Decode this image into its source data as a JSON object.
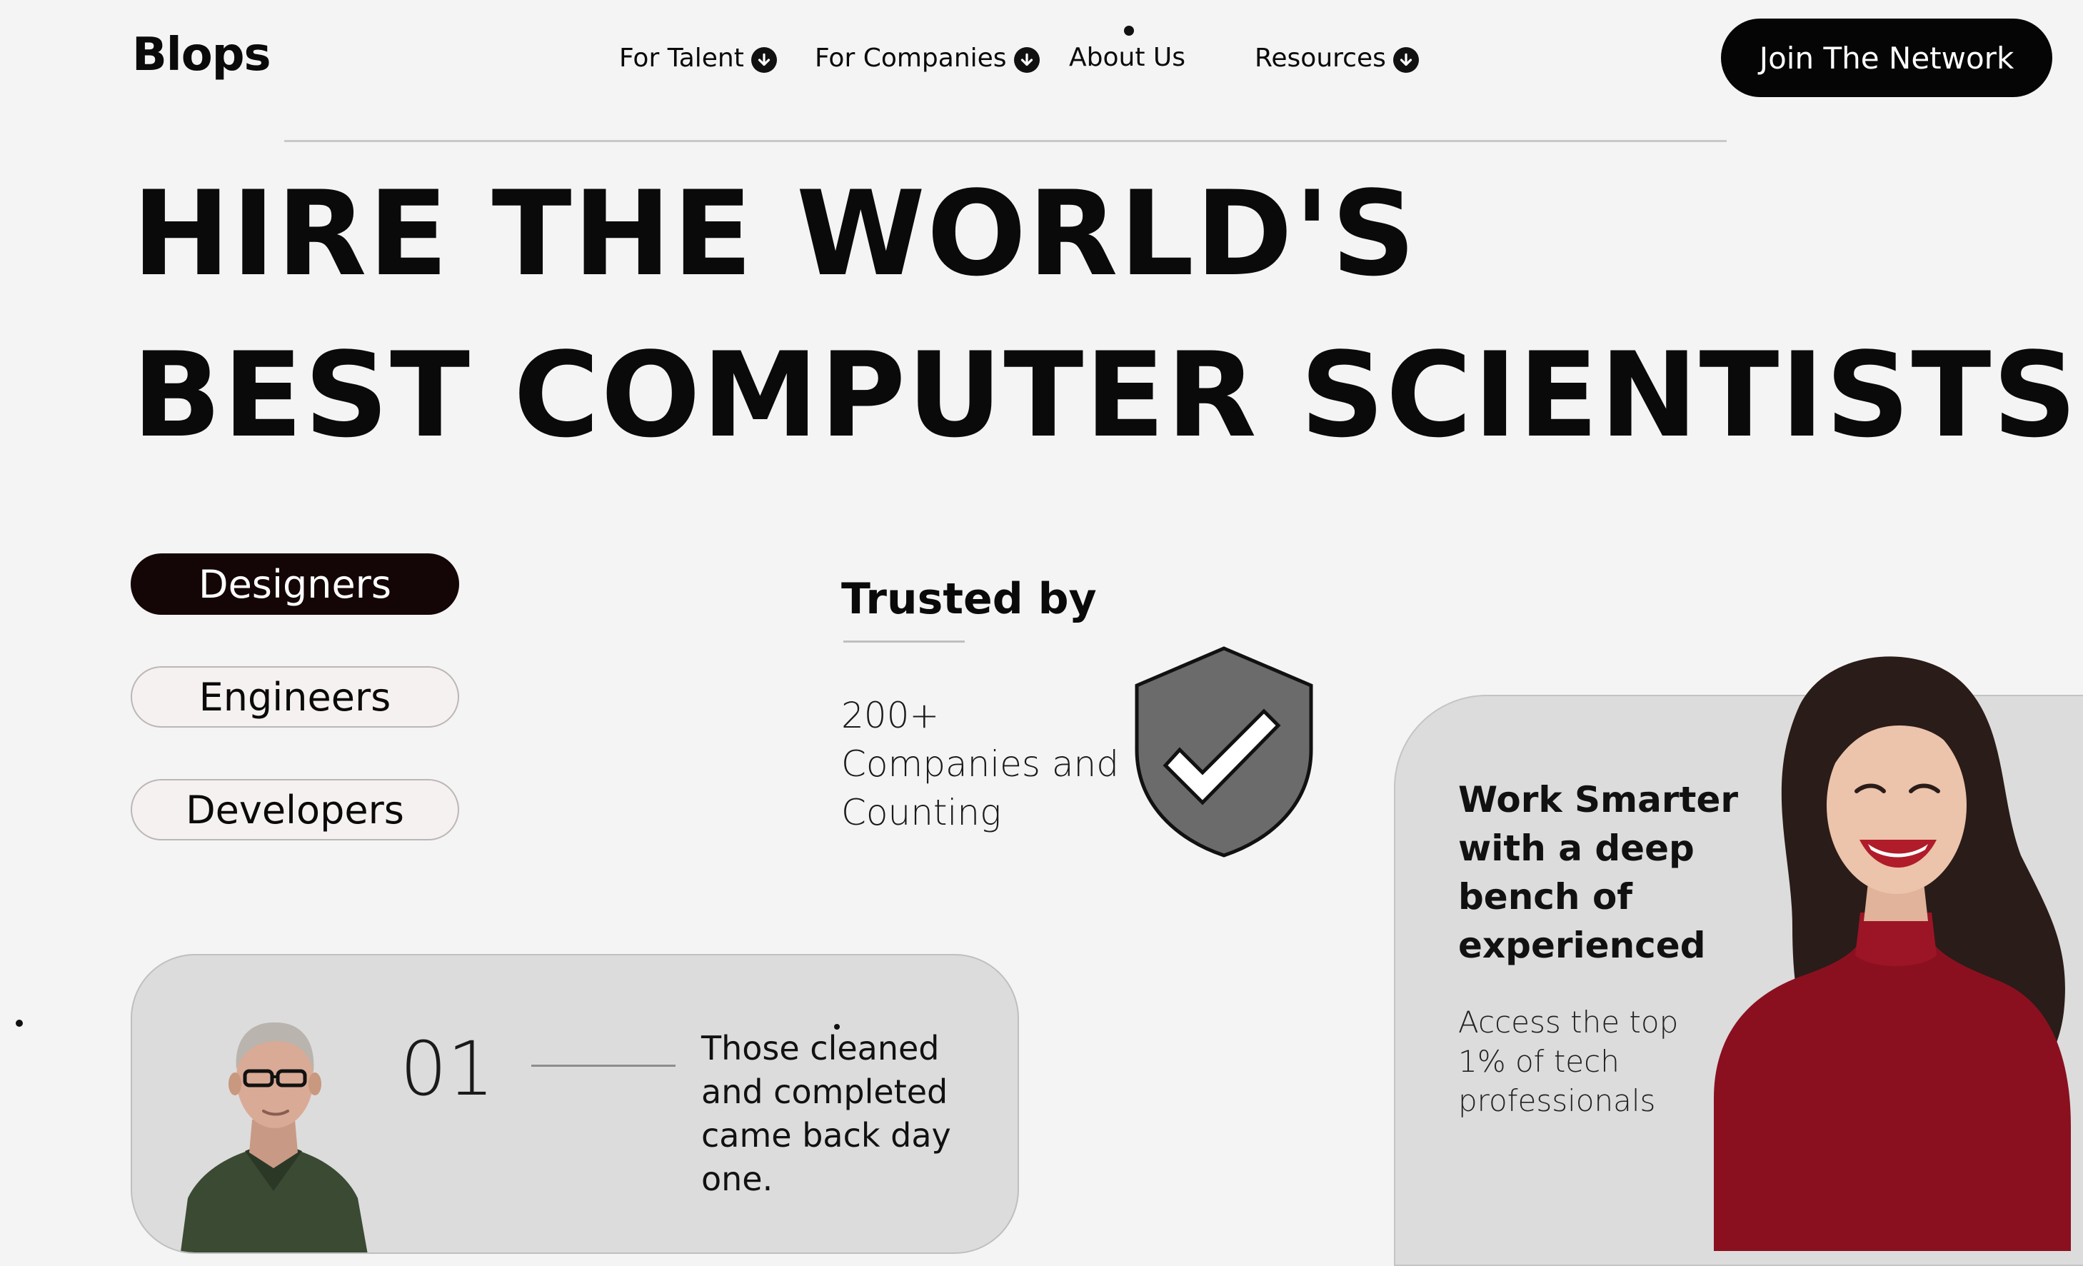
{
  "header": {
    "logo": "Blops",
    "nav": [
      {
        "label": "For Talent",
        "has_dropdown": true
      },
      {
        "label": "For Companies",
        "has_dropdown": true
      },
      {
        "label": "About Us",
        "has_dropdown": false
      },
      {
        "label": "Resources",
        "has_dropdown": true
      }
    ],
    "cta_label": "Join The Network"
  },
  "hero": {
    "line1": "HIRE THE WORLD'S",
    "line2": "BEST COMPUTER SCIENTISTS"
  },
  "categories": [
    {
      "label": "Designers",
      "active": true
    },
    {
      "label": "Engineers",
      "active": false
    },
    {
      "label": "Developers",
      "active": false
    }
  ],
  "trusted": {
    "title": "Trusted by",
    "line1": "200+",
    "line2": "Companies and",
    "line3": "Counting"
  },
  "testimonial": {
    "number": "01",
    "text": "Those cleaned and completed came back day one."
  },
  "feature": {
    "title": "Work Smarter with a deep bench of experienced",
    "text": "Access the top 1% of tech professionals"
  },
  "colors": {
    "background": "#f4f4f4",
    "primary": "#050505",
    "active_pill": "#140607",
    "card": "#dcdcdc",
    "shield": "#6b6b6b"
  }
}
